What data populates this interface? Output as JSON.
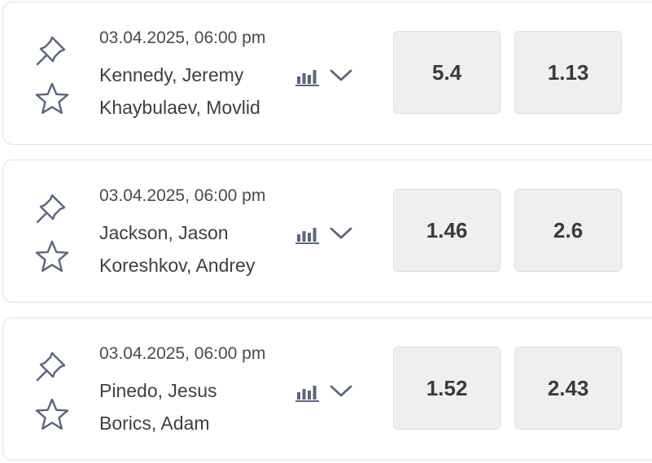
{
  "events": [
    {
      "datetime": "03.04.2025, 06:00 pm",
      "player1": "Kennedy, Jeremy",
      "player2": "Khaybulaev, Movlid",
      "odds": [
        "5.4",
        "1.13"
      ]
    },
    {
      "datetime": "03.04.2025, 06:00 pm",
      "player1": "Jackson, Jason",
      "player2": "Koreshkov, Andrey",
      "odds": [
        "1.46",
        "2.6"
      ]
    },
    {
      "datetime": "03.04.2025, 06:00 pm",
      "player1": "Pinedo, Jesus",
      "player2": "Borics, Adam",
      "odds": [
        "1.52",
        "2.43"
      ]
    }
  ],
  "icons": {
    "pin": "pin-icon",
    "favorite": "star-icon",
    "stats": "stats-bars-icon",
    "expand": "chevron-down-icon"
  },
  "colors": {
    "icon": "#5b6580",
    "odds_background": "#efefef",
    "card_border": "#e1e1e1"
  }
}
